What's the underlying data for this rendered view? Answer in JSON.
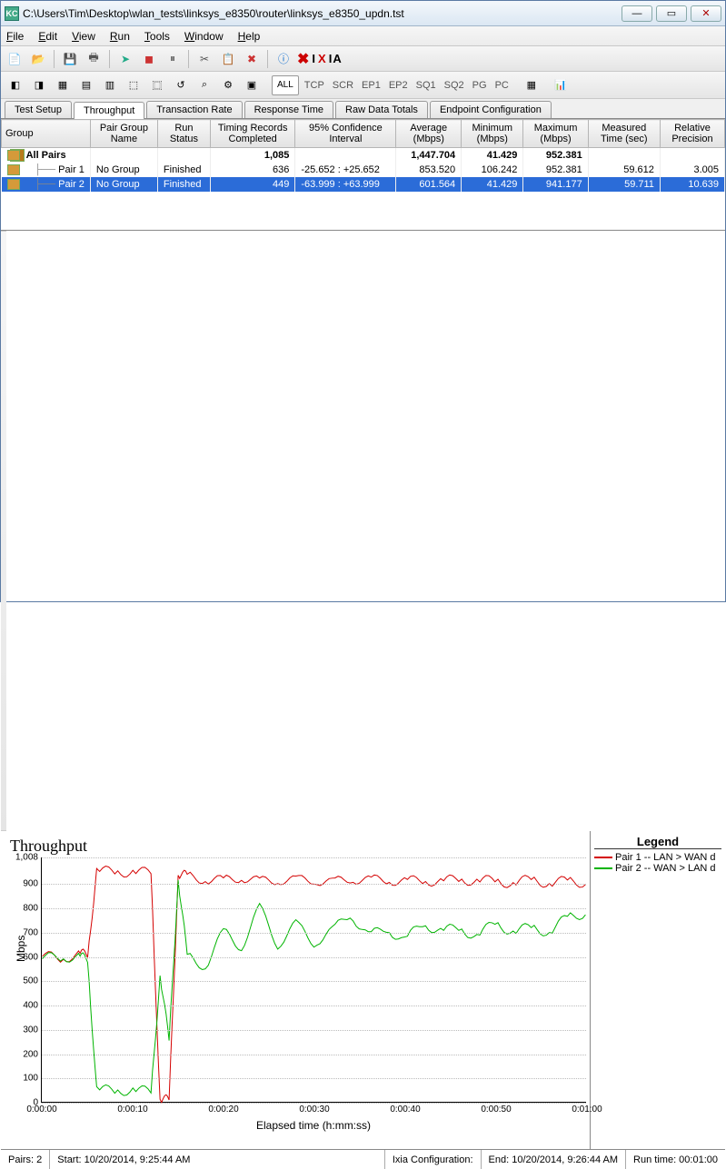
{
  "window": {
    "app_marker": "KC",
    "title": "C:\\Users\\Tim\\Desktop\\wlan_tests\\linksys_e8350\\router\\linksys_e8350_updn.tst"
  },
  "menu": {
    "items": [
      "File",
      "Edit",
      "View",
      "Run",
      "Tools",
      "Window",
      "Help"
    ]
  },
  "toolbar2": {
    "buttons": [
      "ALL",
      "TCP",
      "SCR",
      "EP1",
      "EP2",
      "SQ1",
      "SQ2",
      "PG",
      "PC"
    ]
  },
  "tabs": [
    "Test Setup",
    "Throughput",
    "Transaction Rate",
    "Response Time",
    "Raw Data Totals",
    "Endpoint Configuration"
  ],
  "active_tab": "Throughput",
  "columns": [
    "Group",
    "Pair Group Name",
    "Run Status",
    "Timing Records Completed",
    "95% Confidence Interval",
    "Average (Mbps)",
    "Minimum (Mbps)",
    "Maximum (Mbps)",
    "Measured Time (sec)",
    "Relative Precision"
  ],
  "rows": [
    {
      "group": "All Pairs",
      "pgname": "",
      "status": "",
      "trc": "1,085",
      "ci": "",
      "avg": "1,447.704",
      "min": "41.429",
      "max": "952.381",
      "mt": "",
      "rp": "",
      "bold": true
    },
    {
      "group": "Pair 1",
      "pgname": "No Group",
      "status": "Finished",
      "trc": "636",
      "ci": "-25.652 : +25.652",
      "avg": "853.520",
      "min": "106.242",
      "max": "952.381",
      "mt": "59.612",
      "rp": "3.005"
    },
    {
      "group": "Pair 2",
      "pgname": "No Group",
      "status": "Finished",
      "trc": "449",
      "ci": "-63.999 : +63.999",
      "avg": "601.564",
      "min": "41.429",
      "max": "941.177",
      "mt": "59.711",
      "rp": "10.639",
      "selected": true
    }
  ],
  "legend": [
    {
      "label": "Pair 1 -- LAN > WAN d",
      "color": "#d40000"
    },
    {
      "label": "Pair 2 -- WAN > LAN d",
      "color": "#00b400"
    }
  ],
  "chart_data": {
    "type": "line",
    "title": "Throughput",
    "xlabel": "Elapsed time (h:mm:ss)",
    "ylabel": "Mbps",
    "ylim": [
      0,
      1008
    ],
    "yticks": [
      0,
      100,
      200,
      300,
      400,
      500,
      600,
      700,
      800,
      900,
      1008
    ],
    "xticks": [
      "0:00:00",
      "0:00:10",
      "0:00:20",
      "0:00:30",
      "0:00:40",
      "0:00:50",
      "0:01:00"
    ],
    "x": [
      0,
      2,
      4,
      5,
      6,
      8,
      10,
      12,
      13,
      14,
      15,
      16,
      18,
      20,
      22,
      24,
      26,
      28,
      30,
      32,
      34,
      36,
      38,
      40,
      42,
      44,
      46,
      48,
      50,
      52,
      54,
      56,
      58,
      60
    ],
    "series": [
      {
        "name": "Pair 1 -- LAN > WAN d",
        "color": "#d40000",
        "values": [
          600,
          595,
          605,
          610,
          950,
          950,
          948,
          945,
          10,
          5,
          940,
          930,
          920,
          910,
          930,
          905,
          920,
          910,
          920,
          900,
          925,
          910,
          920,
          905,
          918,
          905,
          922,
          908,
          915,
          900,
          918,
          902,
          910,
          905
        ]
      },
      {
        "name": "Pair 2 -- WAN > LAN d",
        "color": "#00b400",
        "values": [
          590,
          600,
          595,
          590,
          50,
          45,
          50,
          40,
          520,
          250,
          920,
          600,
          560,
          700,
          640,
          800,
          650,
          730,
          660,
          700,
          780,
          680,
          720,
          660,
          740,
          700,
          720,
          680,
          740,
          700,
          720,
          700,
          760,
          780
        ]
      }
    ]
  },
  "status": {
    "pairs": "Pairs: 2",
    "start": "Start: 10/20/2014, 9:25:44 AM",
    "ixia": "Ixia Configuration:",
    "end": "End: 10/20/2014, 9:26:44 AM",
    "runtime": "Run time: 00:01:00"
  }
}
